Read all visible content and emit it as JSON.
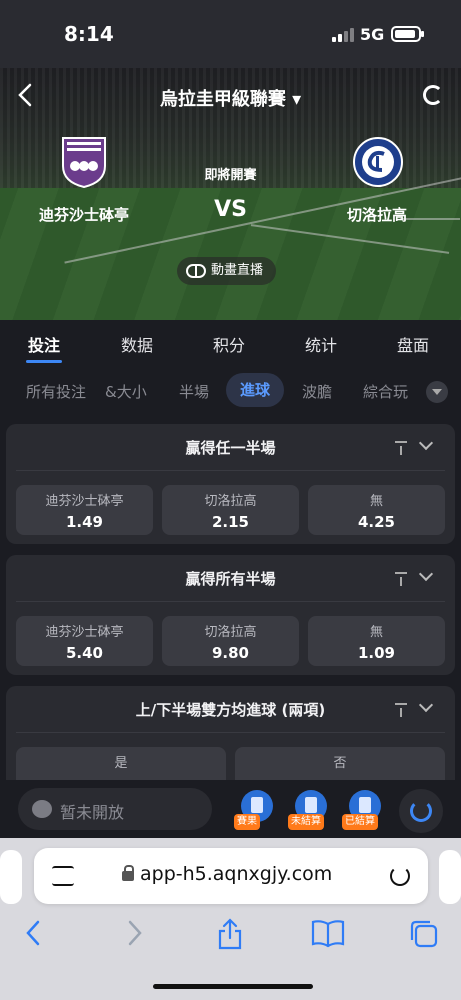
{
  "status_bar": {
    "time": "8:14",
    "network": "5G"
  },
  "header": {
    "title": "烏拉圭甲級聯賽 ▾"
  },
  "match": {
    "home_team": "迪芬沙士砵亭",
    "away_team": "切洛拉高",
    "status": "即將開賽",
    "vs": "VS",
    "live_label": "動畫直播"
  },
  "main_tabs": [
    {
      "label": "投注",
      "active": true
    },
    {
      "label": "数据"
    },
    {
      "label": "积分"
    },
    {
      "label": "统计"
    },
    {
      "label": "盘面"
    }
  ],
  "sub_tabs": [
    {
      "label": "所有投注"
    },
    {
      "label": "&大小"
    },
    {
      "label": "半場"
    },
    {
      "label": "進球",
      "active": true
    },
    {
      "label": "波膽"
    },
    {
      "label": "綜合玩"
    }
  ],
  "markets": [
    {
      "title": "贏得任一半場",
      "odds": [
        {
          "label": "迪芬沙士砵亭",
          "value": "1.49"
        },
        {
          "label": "切洛拉高",
          "value": "2.15"
        },
        {
          "label": "無",
          "value": "4.25"
        }
      ]
    },
    {
      "title": "贏得所有半場",
      "odds": [
        {
          "label": "迪芬沙士砵亭",
          "value": "5.40"
        },
        {
          "label": "切洛拉高",
          "value": "9.80"
        },
        {
          "label": "無",
          "value": "1.09"
        }
      ]
    },
    {
      "title": "上/下半場雙方均進球 (兩項)",
      "options": [
        {
          "label": "是"
        },
        {
          "label": "否"
        }
      ]
    }
  ],
  "bottom_bar": {
    "bet_placeholder": "暂未開放",
    "tags": [
      "賽果",
      "未結算",
      "已結算"
    ]
  },
  "browser": {
    "url": "app-h5.aqnxgjy.com"
  }
}
